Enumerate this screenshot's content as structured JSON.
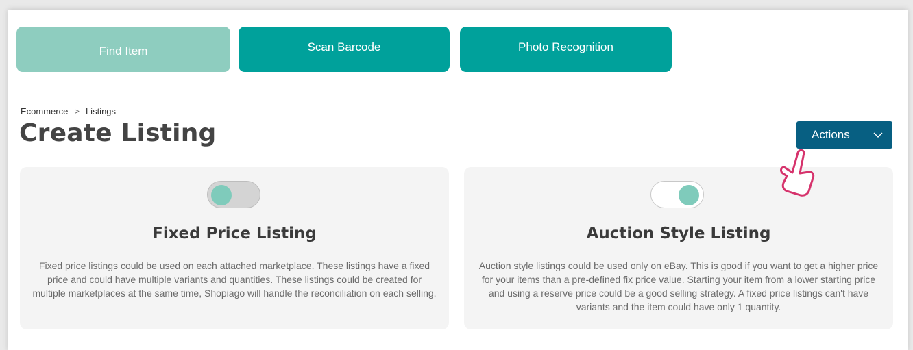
{
  "top_buttons": {
    "find_item": "Find Item",
    "scan_barcode": "Scan Barcode",
    "photo_recognition": "Photo Recognition"
  },
  "breadcrumb": {
    "root": "Ecommerce",
    "separator": ">",
    "current": "Listings"
  },
  "page_title": "Create Listing",
  "actions": {
    "label": "Actions",
    "icon": "chevron-down-icon"
  },
  "cards": [
    {
      "title": "Fixed Price Listing",
      "toggle_on": false,
      "description": "Fixed price listings could be used on each attached marketplace. These listings have a fixed price and could have multiple variants and quantities. These listings could be created for multiple marketplaces at the same time, Shopiago will handle the reconciliation on each selling."
    },
    {
      "title": "Auction Style Listing",
      "toggle_on": true,
      "description": "Auction style listings could be used only on eBay. This is good if you want to get a higher price for your items than a pre-defined fix price value. Starting your item from a lower starting price and using a reserve price could be a good selling strategy. A fixed price listings can't have variants and the item could have only 1 quantity."
    }
  ],
  "colors": {
    "primary_button": "#00a19b",
    "light_button": "#8ecdbf",
    "actions_button": "#075f82",
    "toggle_knob": "#7fcbbb",
    "cursor_outline": "#d6336c"
  }
}
